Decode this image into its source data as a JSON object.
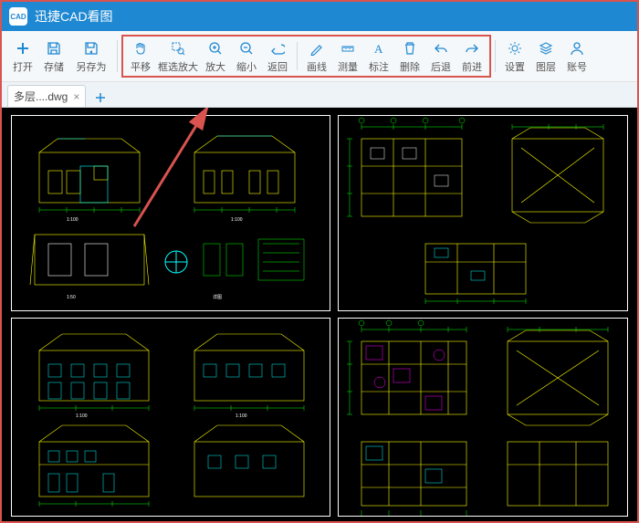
{
  "app": {
    "title": "迅捷CAD看图",
    "logo_text": "CAD"
  },
  "toolbar": {
    "file": {
      "open": "打开",
      "save": "存储",
      "saveas": "另存为"
    },
    "view": {
      "pan": "平移",
      "zoomwin": "框选放大",
      "zoomin": "放大",
      "zoomout": "缩小",
      "back": "返回"
    },
    "edit": {
      "line": "画线",
      "measure": "测量",
      "annotate": "标注",
      "delete": "删除",
      "undo": "后退",
      "redo": "前进"
    },
    "right": {
      "settings": "设置",
      "layers": "图层",
      "account": "账号"
    }
  },
  "tabs": {
    "active": "多层....dwg"
  }
}
